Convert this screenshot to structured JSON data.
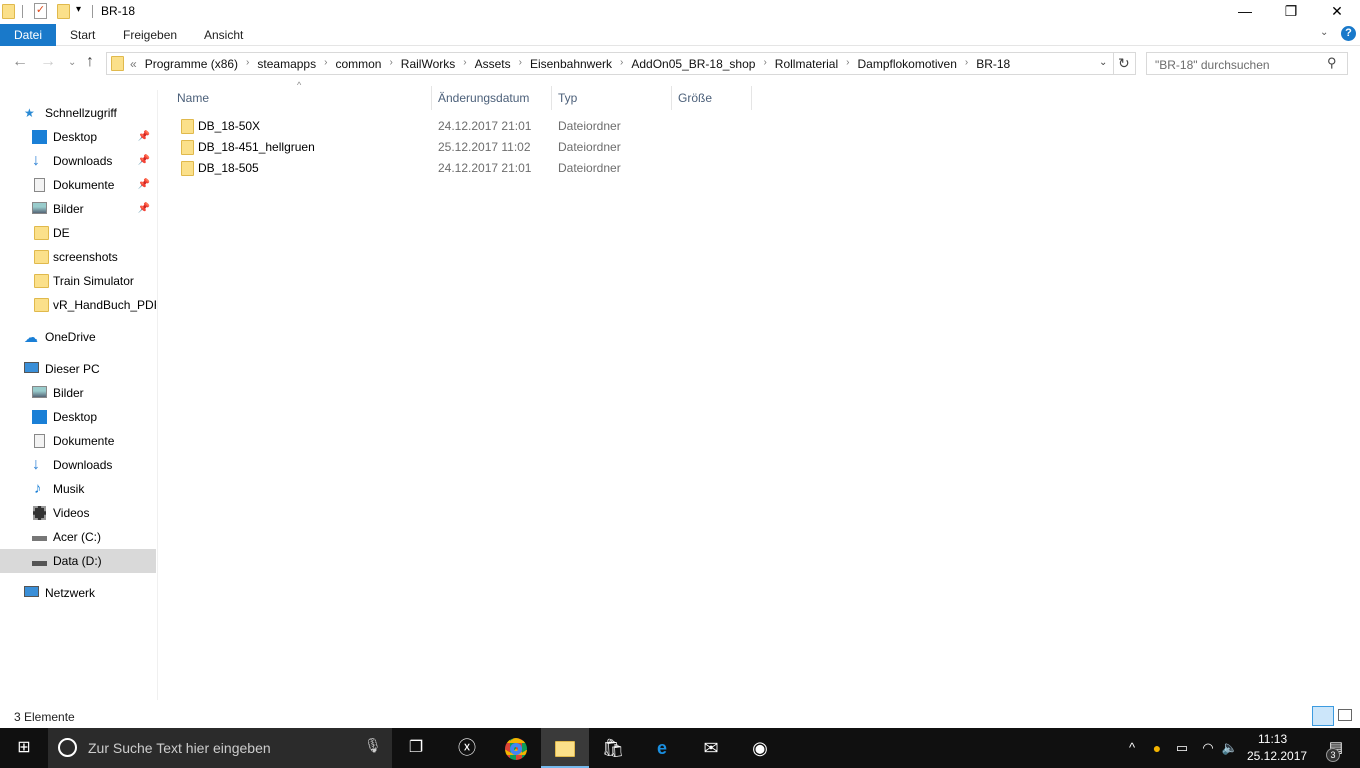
{
  "window": {
    "title": "BR-18",
    "minimize": "—",
    "maximize": "❐",
    "close": "✕"
  },
  "ribbon": {
    "tabs": [
      "Datei",
      "Start",
      "Freigeben",
      "Ansicht"
    ],
    "help": "?"
  },
  "address": {
    "overflow": "«",
    "crumbs": [
      "Programme (x86)",
      "steamapps",
      "common",
      "RailWorks",
      "Assets",
      "Eisenbahnwerk",
      "AddOn05_BR-18_shop",
      "Rollmaterial",
      "Dampflokomotiven",
      "BR-18"
    ]
  },
  "search": {
    "placeholder": "\"BR-18\" durchsuchen"
  },
  "sidebar": {
    "quick": "Schnellzugriff",
    "quick_items": [
      {
        "label": "Desktop",
        "pinned": true
      },
      {
        "label": "Downloads",
        "pinned": true
      },
      {
        "label": "Dokumente",
        "pinned": true
      },
      {
        "label": "Bilder",
        "pinned": true
      },
      {
        "label": "DE"
      },
      {
        "label": "screenshots"
      },
      {
        "label": "Train Simulator"
      },
      {
        "label": "vR_HandBuch_PDF_"
      }
    ],
    "onedrive": "OneDrive",
    "pc": "Dieser PC",
    "pc_items": [
      "Bilder",
      "Desktop",
      "Dokumente",
      "Downloads",
      "Musik",
      "Videos",
      "Acer (C:)",
      "Data (D:)"
    ],
    "network": "Netzwerk"
  },
  "columns": [
    "Name",
    "Änderungsdatum",
    "Typ",
    "Größe"
  ],
  "files": [
    {
      "name": "DB_18-50X",
      "date": "24.12.2017 21:01",
      "type": "Dateiordner"
    },
    {
      "name": "DB_18-451_hellgruen",
      "date": "25.12.2017 11:02",
      "type": "Dateiordner"
    },
    {
      "name": "DB_18-505",
      "date": "24.12.2017 21:01",
      "type": "Dateiordner"
    }
  ],
  "status": "3 Elemente",
  "taskbar": {
    "search": "Zur Suche Text hier eingeben",
    "time": "11:13",
    "date": "25.12.2017",
    "notifications": "3"
  }
}
